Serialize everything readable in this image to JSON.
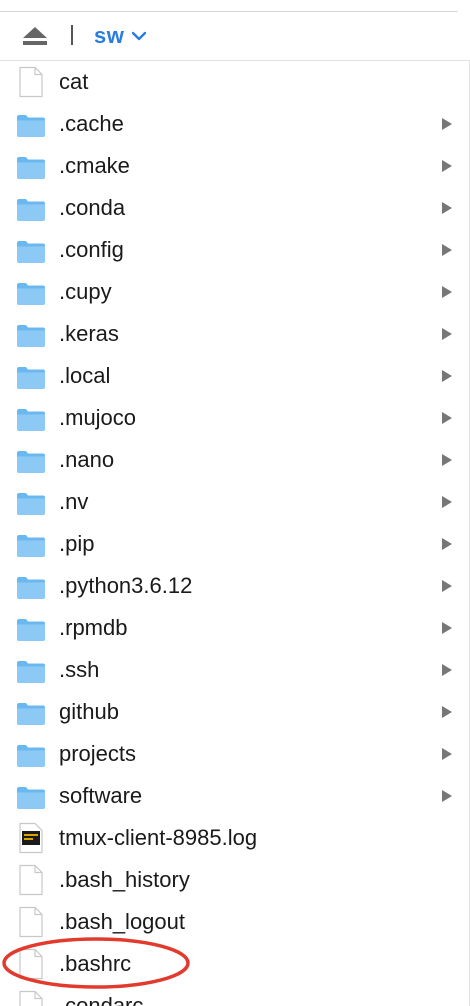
{
  "toolbar": {
    "eject_icon": "eject-icon",
    "path_label": "sw",
    "path_chevron_icon": "chevron-down-icon",
    "accent_color": "#2a7ddf"
  },
  "files": [
    {
      "name": "cat",
      "type": "file",
      "icon": "file-icon"
    },
    {
      "name": ".cache",
      "type": "folder",
      "icon": "folder-icon"
    },
    {
      "name": ".cmake",
      "type": "folder",
      "icon": "folder-icon"
    },
    {
      "name": ".conda",
      "type": "folder",
      "icon": "folder-icon"
    },
    {
      "name": ".config",
      "type": "folder",
      "icon": "folder-icon"
    },
    {
      "name": ".cupy",
      "type": "folder",
      "icon": "folder-icon"
    },
    {
      "name": ".keras",
      "type": "folder",
      "icon": "folder-icon"
    },
    {
      "name": ".local",
      "type": "folder",
      "icon": "folder-icon"
    },
    {
      "name": ".mujoco",
      "type": "folder",
      "icon": "folder-icon"
    },
    {
      "name": ".nano",
      "type": "folder",
      "icon": "folder-icon"
    },
    {
      "name": ".nv",
      "type": "folder",
      "icon": "folder-icon"
    },
    {
      "name": ".pip",
      "type": "folder",
      "icon": "folder-icon"
    },
    {
      "name": ".python3.6.12",
      "type": "folder",
      "icon": "folder-icon"
    },
    {
      "name": ".rpmdb",
      "type": "folder",
      "icon": "folder-icon"
    },
    {
      "name": ".ssh",
      "type": "folder",
      "icon": "folder-icon"
    },
    {
      "name": "github",
      "type": "folder",
      "icon": "folder-icon"
    },
    {
      "name": "projects",
      "type": "folder",
      "icon": "folder-icon"
    },
    {
      "name": "software",
      "type": "folder",
      "icon": "folder-icon"
    },
    {
      "name": "tmux-client-8985.log",
      "type": "log",
      "icon": "log-file-icon"
    },
    {
      "name": ".bash_history",
      "type": "file",
      "icon": "file-icon"
    },
    {
      "name": ".bash_logout",
      "type": "file",
      "icon": "file-icon"
    },
    {
      "name": ".bashrc",
      "type": "file",
      "icon": "file-icon",
      "highlighted": true
    },
    {
      "name": ".condarc",
      "type": "file",
      "icon": "file-icon"
    }
  ],
  "colors": {
    "folder_fill": "#6bb8f0",
    "folder_tab": "#8ccaf5",
    "disclosure": "#777777",
    "highlight": "#e23b2e",
    "file_outline": "#c8c8c8"
  }
}
